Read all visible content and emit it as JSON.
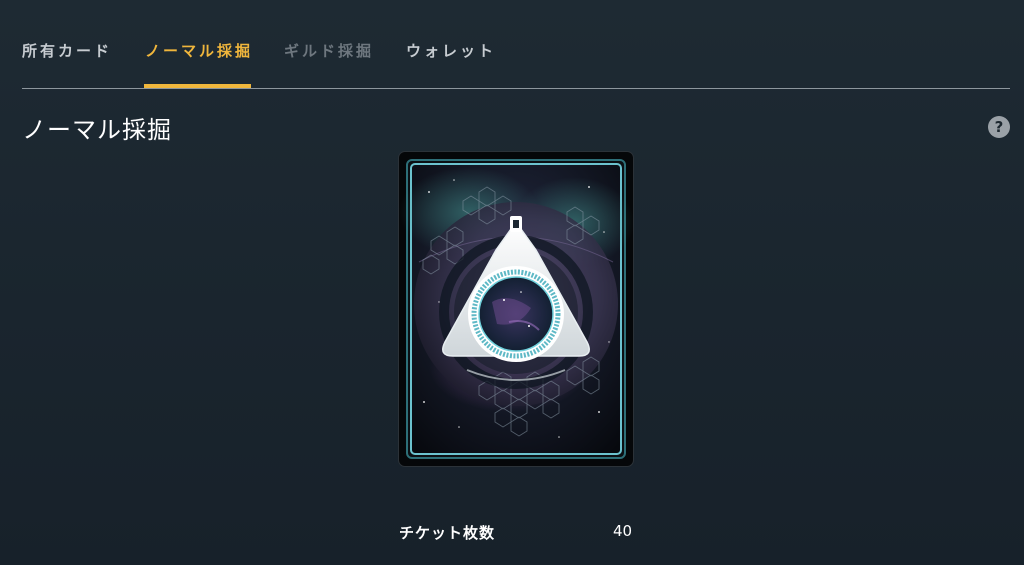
{
  "tabs": [
    {
      "label": "所有カード",
      "state": "inactive"
    },
    {
      "label": "ノーマル採掘",
      "state": "active"
    },
    {
      "label": "ギルド採掘",
      "state": "disabled"
    },
    {
      "label": "ウォレット",
      "state": "inactive"
    }
  ],
  "page": {
    "title": "ノーマル採掘",
    "help_icon": "?"
  },
  "card": {
    "emblem_icon": "triangle-ring-emblem"
  },
  "ticket": {
    "label": "チケット枚数",
    "count": "40"
  },
  "colors": {
    "accent": "#f0b63c",
    "background": "#1c2730",
    "card_frame": "#5fb9c6"
  }
}
